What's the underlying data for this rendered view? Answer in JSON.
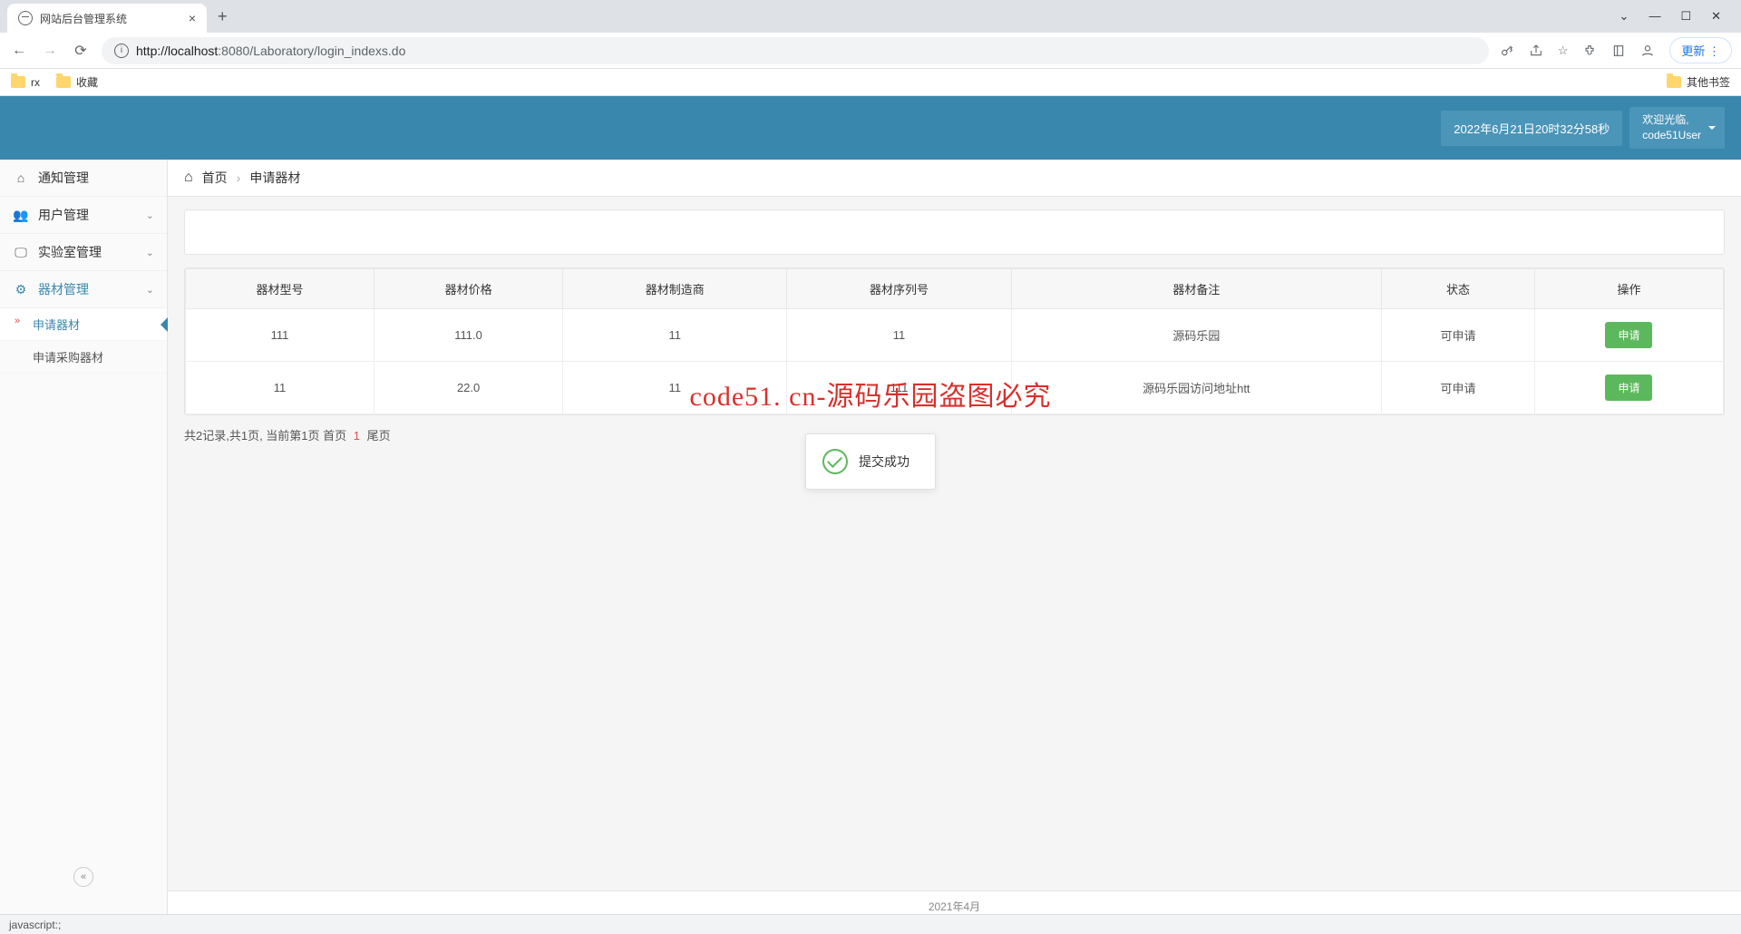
{
  "browser": {
    "tab_title": "网站后台管理系统",
    "url_host": "localhost",
    "url_port": ":8080",
    "url_path": "/Laboratory/login_indexs.do",
    "update_btn": "更新",
    "bookmarks": {
      "b1": "rx",
      "b2": "收藏",
      "others": "其他书签"
    }
  },
  "header": {
    "datetime": "2022年6月21日20时32分58秒",
    "welcome": "欢迎光临,",
    "username": "code51User"
  },
  "sidebar": {
    "notice": "通知管理",
    "user": "用户管理",
    "lab": "实验室管理",
    "equip": "器材管理",
    "sub_apply": "申请器材",
    "sub_purchase": "申请采购器材"
  },
  "crumb": {
    "home": "首页",
    "current": "申请器材"
  },
  "table": {
    "headers": {
      "model": "器材型号",
      "price": "器材价格",
      "maker": "器材制造商",
      "serial": "器材序列号",
      "note": "器材备注",
      "status": "状态",
      "action": "操作"
    },
    "rows": [
      {
        "model": "111",
        "price": "111.0",
        "maker": "11",
        "serial": "11",
        "note": "源码乐园",
        "status": "可申请",
        "action": "申请"
      },
      {
        "model": "11",
        "price": "22.0",
        "maker": "11",
        "serial": "111",
        "note": "源码乐园访问地址htt",
        "status": "可申请",
        "action": "申请"
      }
    ]
  },
  "pager": {
    "summary_a": "共2记录,共1页, 当前第1页 首页",
    "pg1": "1",
    "summary_b": "尾页"
  },
  "toast": {
    "text": "提交成功"
  },
  "watermark": "code51. cn-源码乐园盗图必究",
  "footer": "2021年4月",
  "status_bar": "javascript:;"
}
